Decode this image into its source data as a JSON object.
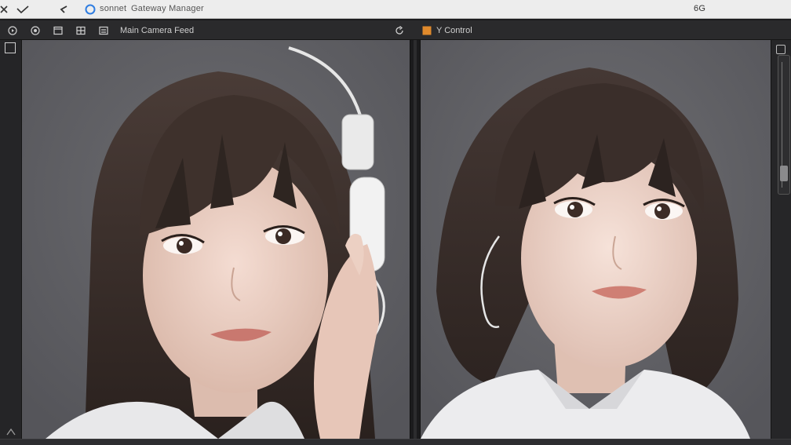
{
  "menubar": {
    "search_text": "sonnet",
    "title_text": "Gateway Manager",
    "right_text": "6G"
  },
  "toolbar": {
    "left_label": "Main Camera Feed",
    "right_label": "Y Control"
  },
  "icons": {
    "close": "close-icon",
    "check": "check-icon",
    "back": "arrow-icon",
    "search": "circle-icon",
    "play": "play-icon",
    "record": "record-icon",
    "window": "window-icon",
    "grid": "grid-icon",
    "menu": "menu-icon",
    "refresh": "refresh-icon"
  },
  "colors": {
    "topbar": "#ededed",
    "toolbar": "#2a2a2c",
    "panel": "#5f5f62",
    "accent_blue": "#2f7de1",
    "accent_orange": "#e08a2c"
  }
}
